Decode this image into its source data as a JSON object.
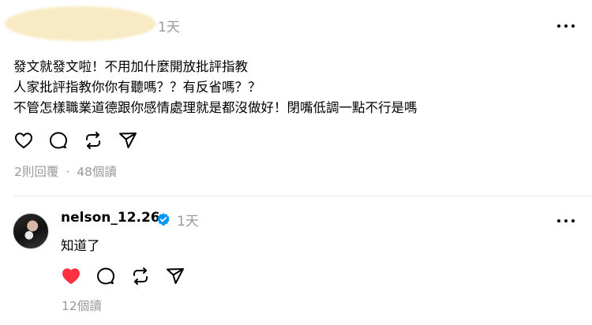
{
  "post": {
    "time": "1天",
    "body_lines": [
      "發文就發文啦！不用加什麼開放批評指教",
      "人家批評指教你你有聽嗎？？有反省嗎？？",
      "不管怎樣職業道德跟你感情處理就是都沒做好！閉嘴低調一點不行是嗎"
    ],
    "replies_count": "2則回覆",
    "separator": "·",
    "views": "48個讀"
  },
  "reply": {
    "username": "nelson_12.26",
    "time": "1天",
    "body": "知道了",
    "liked": true,
    "views": "12個讀"
  },
  "colors": {
    "muted_text": "#999999",
    "like_red": "#ff3040",
    "verified_blue": "#0095f6",
    "divider": "#e5e5e5"
  },
  "icons": [
    "more-icon",
    "heart-icon",
    "comment-icon",
    "repost-icon",
    "share-icon",
    "verified-icon"
  ]
}
